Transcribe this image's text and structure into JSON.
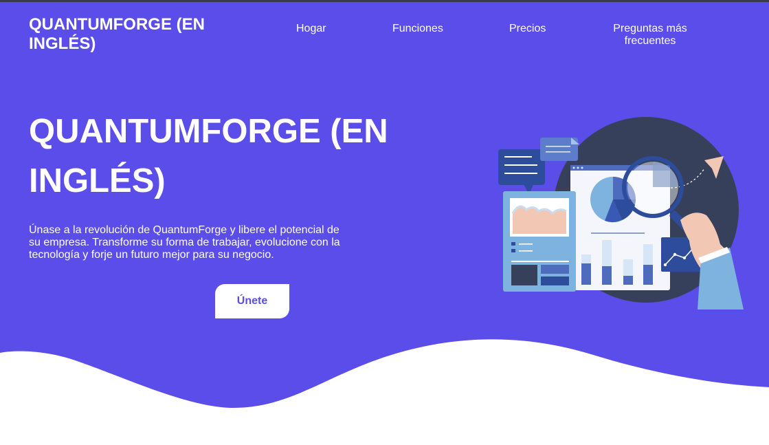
{
  "colors": {
    "hero_background": "#5b4dea",
    "text_primary": "#ffffff",
    "button_background": "#ffffff",
    "button_text": "#5b4dea"
  },
  "header": {
    "brand": "QUANTUMFORGE (EN INGLÉS)",
    "nav": [
      {
        "label": "Hogar"
      },
      {
        "label": "Funciones"
      },
      {
        "label": "Precios"
      },
      {
        "label": "Preguntas más frecuentes"
      }
    ]
  },
  "hero": {
    "title": "QUANTUMFORGE (EN INGLÉS)",
    "description": "Únase a la revolución de QuantumForge y libere el potencial de su empresa. Transforme su forma de trabajar, evolucione con la tecnología y forje un futuro mejor para su negocio.",
    "cta_label": "Únete"
  },
  "illustration": {
    "icons": [
      "chat-bubble-icon",
      "report-document-icon",
      "pie-chart-icon",
      "magnifying-glass-icon",
      "paper-plane-icon",
      "line-chart-icon",
      "hand-icon"
    ]
  }
}
